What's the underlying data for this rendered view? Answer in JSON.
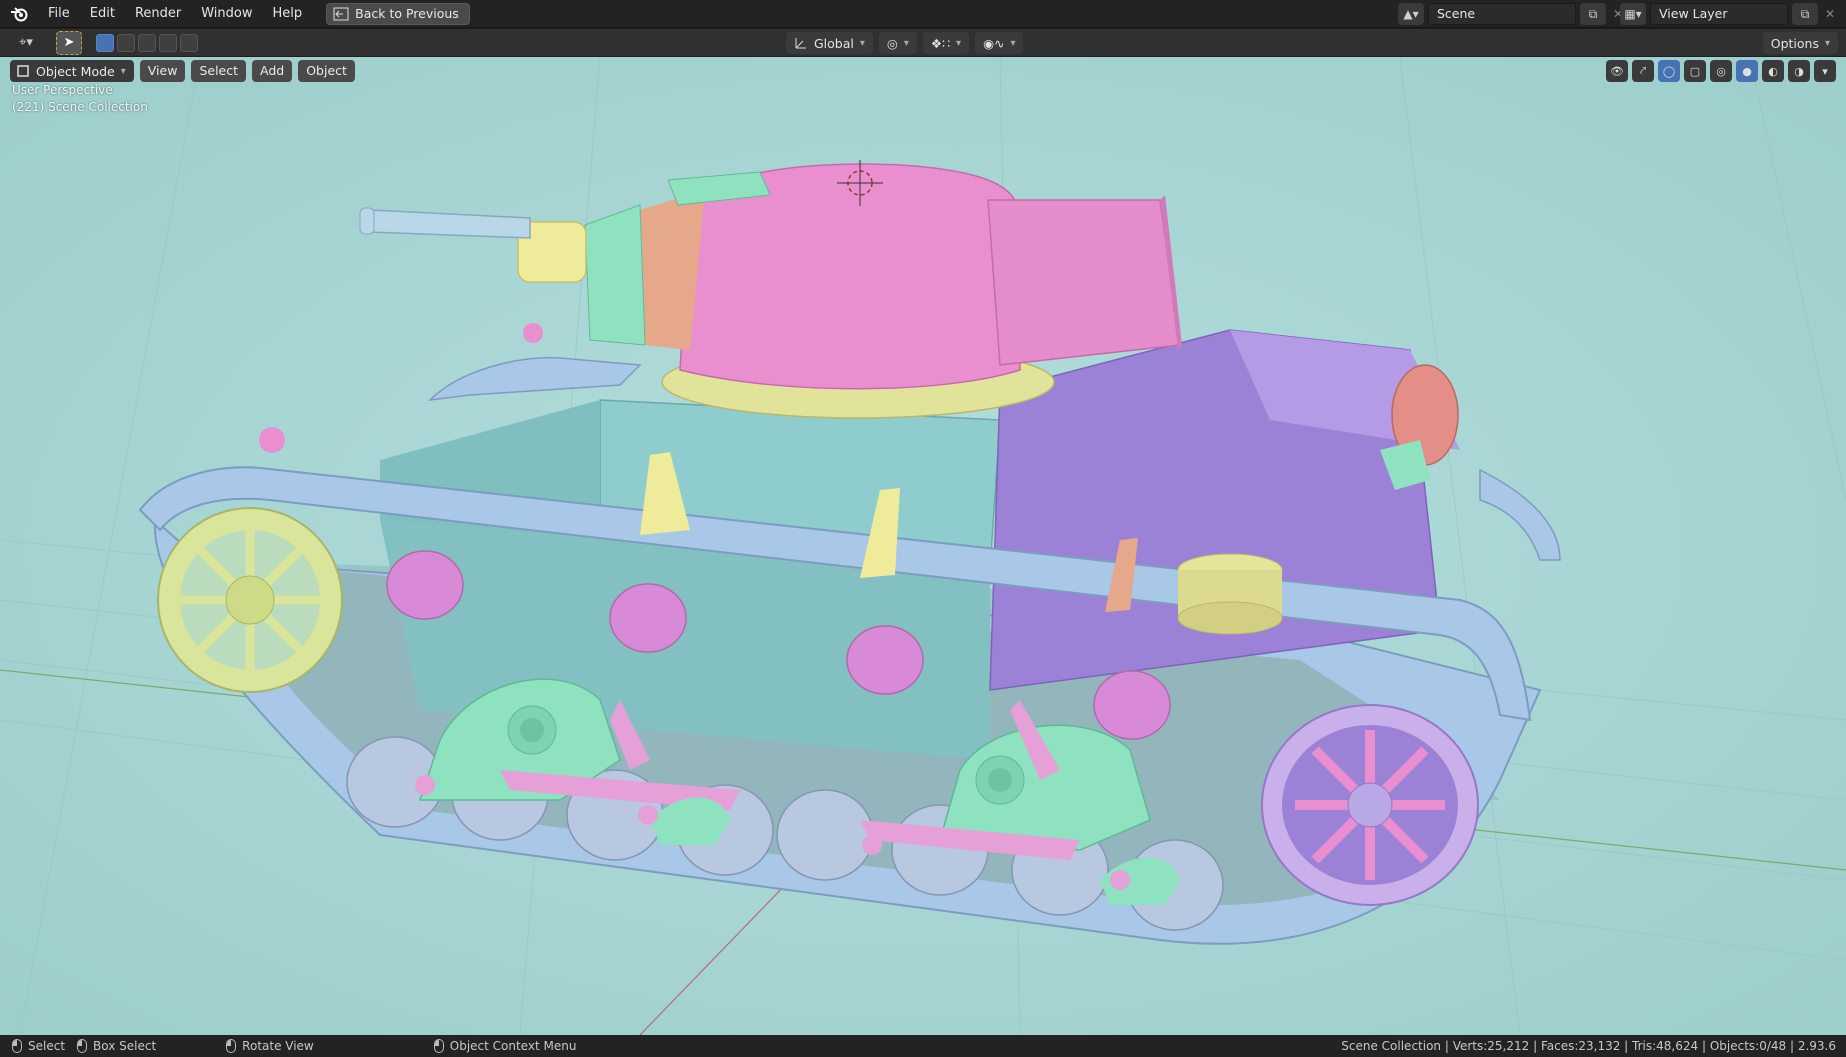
{
  "menu": {
    "items": [
      "File",
      "Edit",
      "Render",
      "Window",
      "Help"
    ],
    "back_label": "Back to Previous"
  },
  "scene": {
    "name": "Scene",
    "view_layer": "View Layer"
  },
  "toolbar": {
    "transform_orientation": "Global",
    "options_label": "Options"
  },
  "viewport_header": {
    "mode": "Object Mode",
    "menus": [
      "View",
      "Select",
      "Add",
      "Object"
    ]
  },
  "viewport_overlay": {
    "perspective": "User Perspective",
    "collection": "(221) Scene Collection"
  },
  "statusbar": {
    "select": "Select",
    "box_select": "Box Select",
    "rotate_view": "Rotate View",
    "context_menu": "Object Context Menu",
    "stats": "Scene Collection | Verts:25,212 | Faces:23,132 | Tris:48,624 | Objects:0/48 | 2.93.6"
  },
  "colors": {
    "viewport_bg": "#a6d6d4",
    "turret": "#e98fd0",
    "hull_rear": "#9c82d6",
    "hull_front": "#8fcccd",
    "track": "#a9c7e6",
    "bogie": "#8ee2c0",
    "sprocket": "#d9e59a",
    "road_wheel": "#d88ad6",
    "accent_select": "#4772b3"
  },
  "icons": [
    "blender-logo-icon",
    "back-icon",
    "scene-icon",
    "view-layer-icon",
    "cursor-tool-icon",
    "transform-orientation-icon",
    "snap-icon",
    "proportional-edit-icon",
    "visibility-icon",
    "gizmo-icon",
    "overlay-icon",
    "xray-icon",
    "wireframe-shading-icon",
    "solid-shading-icon",
    "material-shading-icon",
    "rendered-shading-icon",
    "mouse-left-icon",
    "mouse-middle-icon",
    "mouse-right-icon"
  ]
}
